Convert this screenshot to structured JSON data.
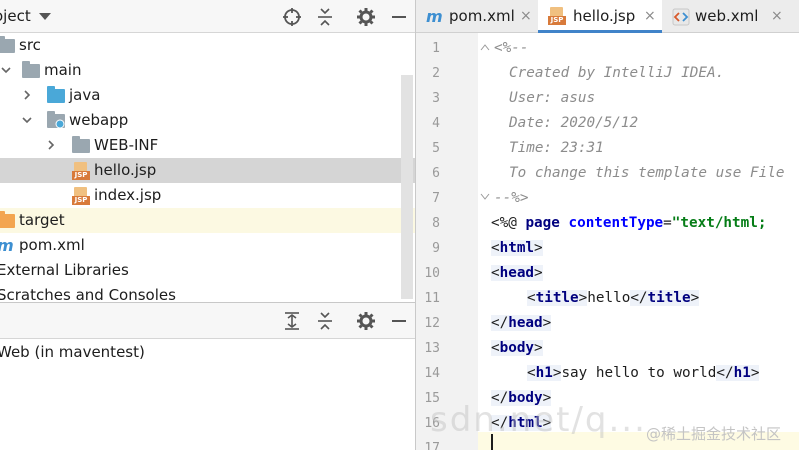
{
  "project": {
    "title": "oject",
    "tree": [
      {
        "label": "src",
        "icon": "folder-grey"
      },
      {
        "label": "main",
        "icon": "folder-grey"
      },
      {
        "label": "java",
        "icon": "folder-blue"
      },
      {
        "label": "webapp",
        "icon": "folder-web"
      },
      {
        "label": "WEB-INF",
        "icon": "folder-grey"
      },
      {
        "label": "hello.jsp",
        "icon": "jsp-file"
      },
      {
        "label": "index.jsp",
        "icon": "jsp-file"
      },
      {
        "label": "target",
        "icon": "folder-orange"
      },
      {
        "label": "pom.xml",
        "icon": "maven-file"
      },
      {
        "label": "External Libraries",
        "icon": ""
      },
      {
        "label": "Scratches and Consoles",
        "icon": ""
      }
    ]
  },
  "services": {
    "item": "Web (in maventest)"
  },
  "editor": {
    "tabs": [
      {
        "label": "pom.xml",
        "close": "×",
        "icon": "maven-icon"
      },
      {
        "label": "hello.jsp",
        "close": "×",
        "icon": "jsp-icon"
      },
      {
        "label": "web.xml",
        "close": "×",
        "icon": "xml-icon"
      }
    ],
    "line_numbers": [
      "1",
      "2",
      "3",
      "4",
      "5",
      "6",
      "7",
      "8",
      "9",
      "10",
      "11",
      "12",
      "13",
      "14",
      "15",
      "16",
      "17"
    ],
    "code": {
      "l1": "<%--",
      "l2": "Created by IntelliJ IDEA.",
      "l3": "User: asus",
      "l4": "Date: 2020/5/12",
      "l5": "Time: 23:31",
      "l6": "To change this template use File",
      "l7": "--%>",
      "l8_open": "<%@ ",
      "l8_kw": "page ",
      "l8_attr": "contentType",
      "l8_eq": "=",
      "l8_str": "\"text/html;",
      "html_open": "html",
      "head_open": "head",
      "title_open": "title",
      "title_text": "hello",
      "title_close": "title",
      "head_close": "head",
      "body_open": "body",
      "h1_open": "h1",
      "h1_text": "say hello to world",
      "h1_close": "h1",
      "body_close": "body",
      "html_close": "html"
    }
  },
  "watermark": {
    "text": "@稀土掘金技术社区",
    "text2": "sdn.net/q..."
  },
  "colors": {
    "accent": "#4083c9",
    "selection": "#d5d5d5",
    "tag": "#00007f",
    "string": "#067d17",
    "comment": "#8c8c8c"
  }
}
